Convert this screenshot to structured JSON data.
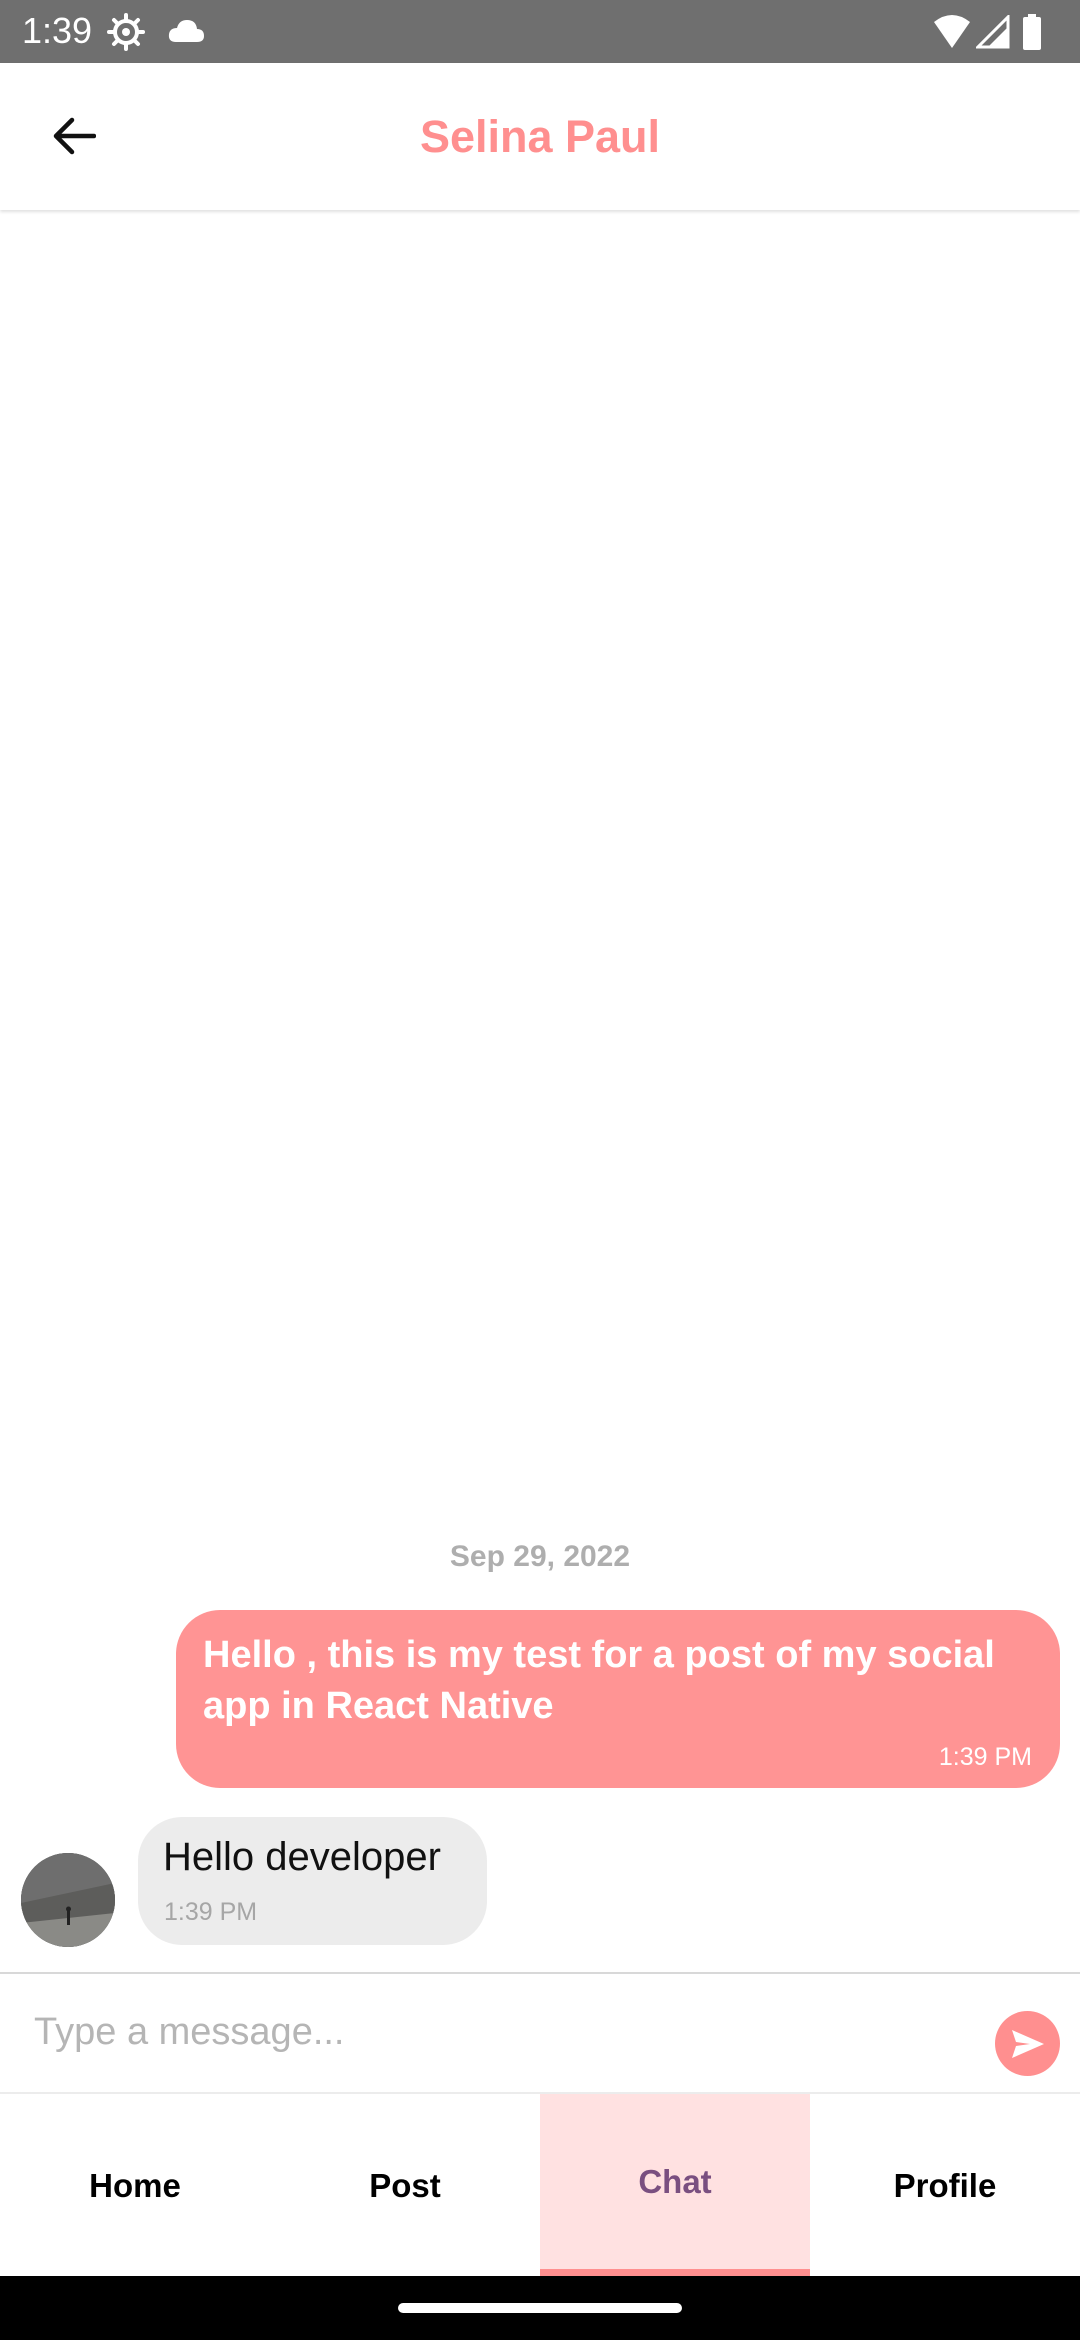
{
  "status_bar": {
    "time": "1:39",
    "left_icons": [
      "settings-icon",
      "cloud-icon"
    ],
    "right_icons": [
      "wifi-icon",
      "signal-icon",
      "battery-icon"
    ]
  },
  "header": {
    "title": "Selina Paul",
    "back_icon": "arrow-left-icon"
  },
  "chat": {
    "date_label": "Sep 29, 2022",
    "messages": [
      {
        "direction": "outgoing",
        "text": "Hello , this is my test for a post of my social app in React Native",
        "time": "1:39 PM"
      },
      {
        "direction": "incoming",
        "text": "Hello developer",
        "time": "1:39 PM"
      }
    ]
  },
  "composer": {
    "placeholder": "Type a message...",
    "value": "",
    "send_icon": "send-icon"
  },
  "tabs": [
    {
      "label": "Home",
      "active": false
    },
    {
      "label": "Post",
      "active": false
    },
    {
      "label": "Chat",
      "active": true
    },
    {
      "label": "Profile",
      "active": false
    }
  ],
  "colors": {
    "accent": "#ff8f8f",
    "outgoing_bubble": "#ff9494",
    "incoming_bubble": "#ececec",
    "active_tab_bg": "#ffe1e1",
    "active_tab_text": "#7a4f80",
    "status_bar": "#6f6f6f"
  }
}
